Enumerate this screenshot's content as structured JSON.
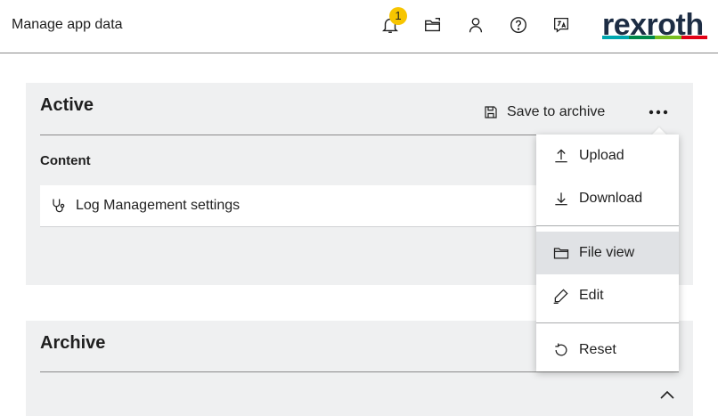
{
  "header": {
    "title": "Manage app data",
    "notification_count": "1",
    "icons": [
      "bell-icon",
      "folder-open-icon",
      "user-icon",
      "help-icon",
      "language-icon"
    ],
    "logo_text": "rexroth",
    "logo_colors": [
      "#00a8b0",
      "#00884a",
      "#78be20",
      "#e20015"
    ]
  },
  "active": {
    "title": "Active",
    "save_label": "Save to archive",
    "content_label": "Content",
    "rows": [
      {
        "icon": "stethoscope-icon",
        "label": "Log Management settings"
      }
    ]
  },
  "archive": {
    "title": "Archive"
  },
  "menu": {
    "items": [
      {
        "icon": "upload-icon",
        "label": "Upload"
      },
      {
        "icon": "download-icon",
        "label": "Download"
      },
      {
        "icon": "folder-icon",
        "label": "File view"
      },
      {
        "icon": "pencil-icon",
        "label": "Edit"
      },
      {
        "icon": "reset-icon",
        "label": "Reset"
      }
    ],
    "highlighted": "File view"
  },
  "colors": {
    "panel_bg": "#eff0f1",
    "badge": "#f7c500",
    "logo": "#1d2d44"
  }
}
